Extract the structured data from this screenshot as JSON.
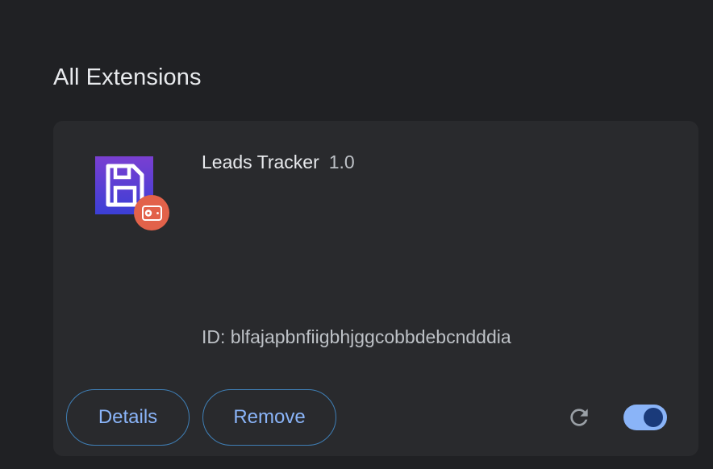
{
  "section": {
    "title": "All Extensions"
  },
  "extension": {
    "name": "Leads Tracker",
    "version": "1.0",
    "id_text": "ID: blfajapbnfiigbhjggcobbdebcndddia",
    "enabled": true,
    "icon": "floppy-disk-icon",
    "badge_icon": "unpacked-extension-badge-icon"
  },
  "actions": {
    "details_label": "Details",
    "remove_label": "Remove",
    "reload_icon": "reload-icon"
  },
  "colors": {
    "background": "#202124",
    "card": "#292a2d",
    "accent": "#8ab4f8",
    "button_border": "#3f7fb6",
    "icon_purple": "#5b3fcf",
    "badge_orange": "#e2624a"
  }
}
